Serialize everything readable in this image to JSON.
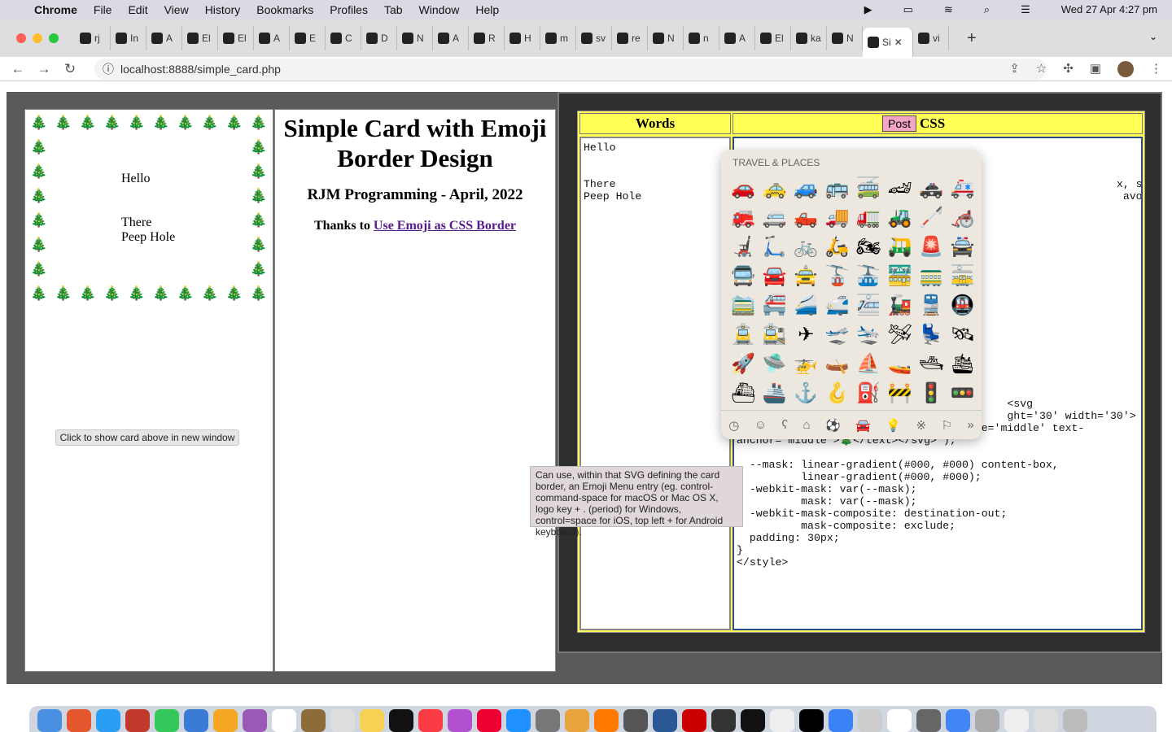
{
  "menubar": {
    "app": "Chrome",
    "items": [
      "File",
      "Edit",
      "View",
      "History",
      "Bookmarks",
      "Profiles",
      "Tab",
      "Window",
      "Help"
    ],
    "datetime": "Wed 27 Apr  4:27 pm"
  },
  "tabs": [
    "rj",
    "In",
    "A",
    "El",
    "El",
    "A",
    "E",
    "C",
    "D",
    "N",
    "A",
    "R",
    "H",
    "m",
    "sv",
    "re",
    "N",
    "n",
    "A",
    "El",
    "ka",
    "N",
    "Si",
    "vi"
  ],
  "active_tab": 22,
  "address": {
    "url": "localhost:8888/simple_card.php"
  },
  "card": {
    "emoji": "🎄",
    "lines": [
      "Hello",
      "There",
      "Peep Hole"
    ],
    "show_button": "Click to show card above in new window"
  },
  "middle": {
    "title": "Simple Card with Emoji Border Design",
    "subtitle": "RJM Programming - April, 2022",
    "thanks": "Thanks to",
    "link": "Use Emoji as CSS Border"
  },
  "editor": {
    "words_header": "Words",
    "post_label": "Post",
    "css_header": "CSS",
    "words_text": "Hello\n\n\nThere\nPeep Hole",
    "css_text": "\n\n\n                                                           x, so we need to keep\n                                                            avoid cutting */\n\n\n\n\n\n\n\n\n\n\n\n\n\n\n\n\n                                          <svg\n                                          ght='30' width='30'>\n<text x='50%' y='50%' dominant-baseline='middle' text-\nanchor='middle'>🎄</text></svg>\");\n\n  --mask: linear-gradient(#000, #000) content-box,\n          linear-gradient(#000, #000);\n  -webkit-mask: var(--mask);\n          mask: var(--mask);\n  -webkit-mask-composite: destination-out;\n          mask-composite: exclude;\n  padding: 30px;\n}\n</style>"
  },
  "emoji_picker": {
    "category": "TRAVEL & PLACES",
    "emojis": [
      "🚗",
      "🚕",
      "🚙",
      "🚌",
      "🚎",
      "🏎",
      "🚓",
      "🚑",
      "🚒",
      "🚐",
      "🛻",
      "🚚",
      "🚛",
      "🚜",
      "🦯",
      "🦽",
      "🦼",
      "🛴",
      "🚲",
      "🛵",
      "🏍",
      "🛺",
      "🚨",
      "🚔",
      "🚍",
      "🚘",
      "🚖",
      "🚡",
      "🚠",
      "🚟",
      "🚃",
      "🚋",
      "🚞",
      "🚝",
      "🚄",
      "🚅",
      "🚈",
      "🚂",
      "🚆",
      "🚇",
      "🚊",
      "🚉",
      "✈",
      "🛫",
      "🛬",
      "🛩",
      "💺",
      "🛰",
      "🚀",
      "🛸",
      "🚁",
      "🛶",
      "⛵",
      "🚤",
      "🛥",
      "🛳",
      "⛴",
      "🚢",
      "⚓",
      "🪝",
      "⛽",
      "🚧",
      "🚦",
      "🚥"
    ],
    "footer_icons": [
      "clock-icon",
      "smiley-icon",
      "bear-icon",
      "food-icon",
      "ball-icon",
      "travel-icon",
      "bulb-icon",
      "symbols-icon",
      "flag-icon",
      "more-icon"
    ],
    "footer_glyphs": [
      "◷",
      "☺",
      "ʕ",
      "⌂",
      "⚽",
      "🚘",
      "💡",
      "※",
      "⚐",
      "»"
    ]
  },
  "tooltip": "Can use, within that SVG defining the card border, an Emoji Menu entry (eg. control-command-space for macOS or Mac OS X, logo key + . (period) for Windows, control=space for iOS, top left + for Android keyboard)."
}
